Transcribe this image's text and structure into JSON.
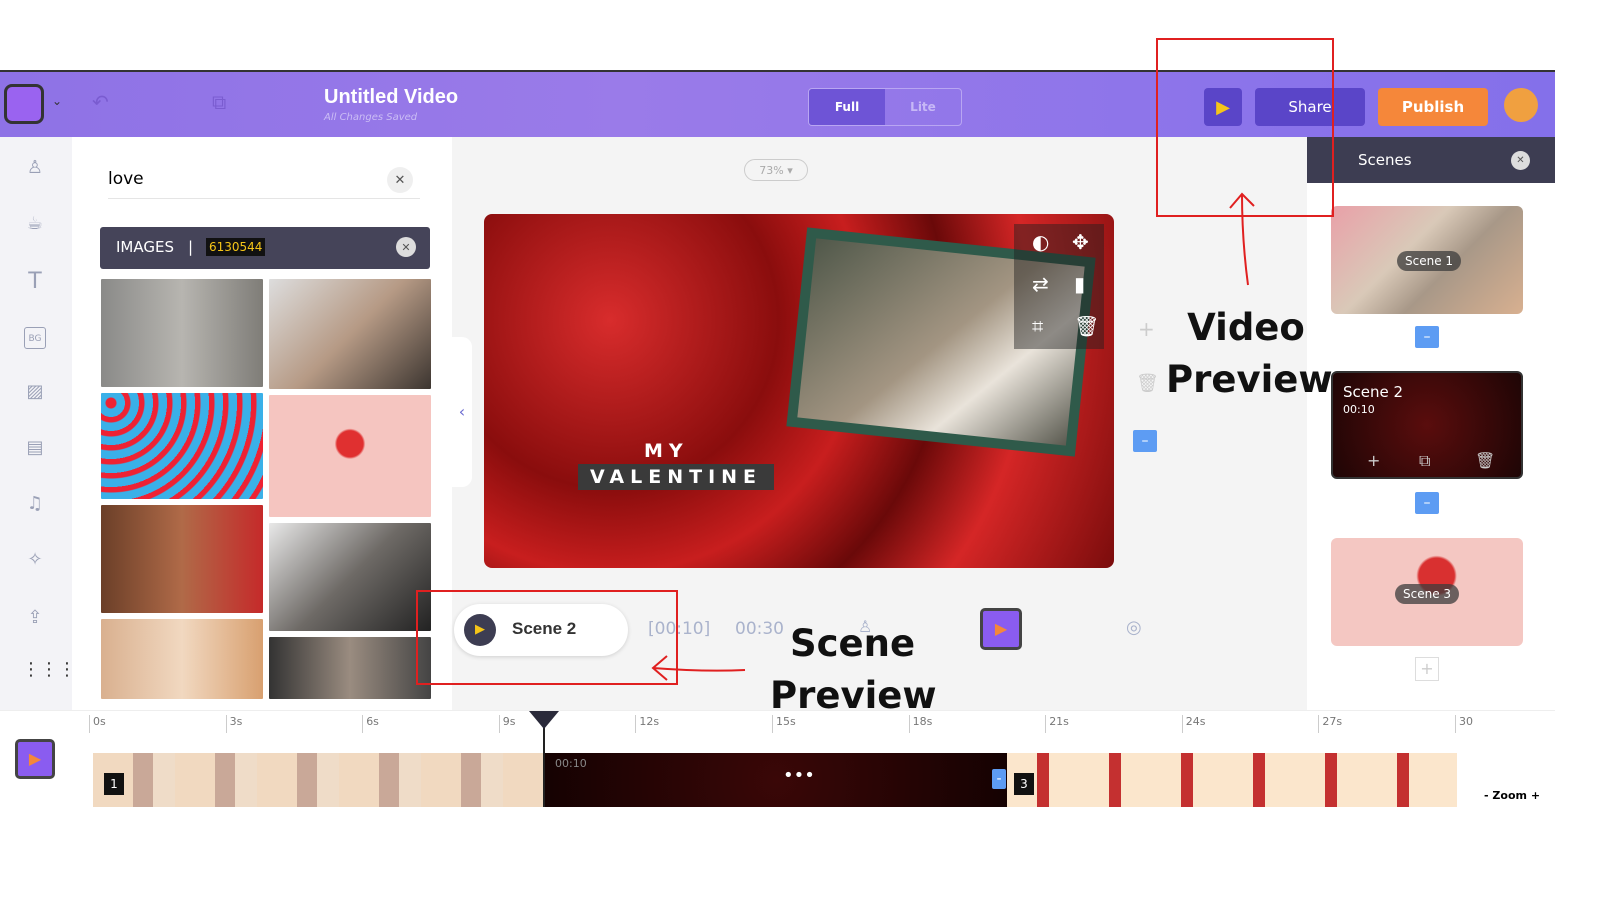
{
  "header": {
    "title": "Untitled Video",
    "subtitle": "All Changes Saved",
    "modes": [
      "Full",
      "Lite"
    ],
    "share": "Share",
    "publish": "Publish"
  },
  "sidebar": {
    "icons": [
      "character-icon",
      "props-icon",
      "text-icon",
      "background-icon",
      "image-icon",
      "video-icon",
      "music-icon",
      "effects-icon",
      "upload-icon",
      "more-grid-icon"
    ],
    "bg_label": "BG"
  },
  "search": {
    "value": "love"
  },
  "images": {
    "label": "IMAGES",
    "separator": "|",
    "count": "6130544"
  },
  "canvas": {
    "zoom": "73%",
    "text_line1": "MY",
    "text_line2": "VALENTINE"
  },
  "scene_preview": {
    "scene": "Scene 2",
    "current": "[00:10]",
    "total": "00:30"
  },
  "scenes": {
    "title": "Scenes",
    "items": [
      {
        "label": "Scene 1"
      },
      {
        "label": "Scene 2",
        "duration": "00:10"
      },
      {
        "label": "Scene 3"
      }
    ]
  },
  "timeline": {
    "ticks": [
      "0s",
      "3s",
      "6s",
      "9s",
      "12s",
      "15s",
      "18s",
      "21s",
      "24s",
      "27s",
      "30"
    ],
    "scene_numbers": [
      "1",
      "3"
    ],
    "scene2_time": "00:10",
    "zoom_label": "Zoom",
    "minus": "-",
    "plus": "+"
  },
  "annotations": {
    "video_preview": [
      "Video",
      "Preview"
    ],
    "scene_preview": [
      "Scene",
      "Preview"
    ]
  },
  "colors": {
    "header": "#8e72e6",
    "publish": "#f5873a",
    "share": "#5a45c8",
    "annotation": "#e02020"
  }
}
